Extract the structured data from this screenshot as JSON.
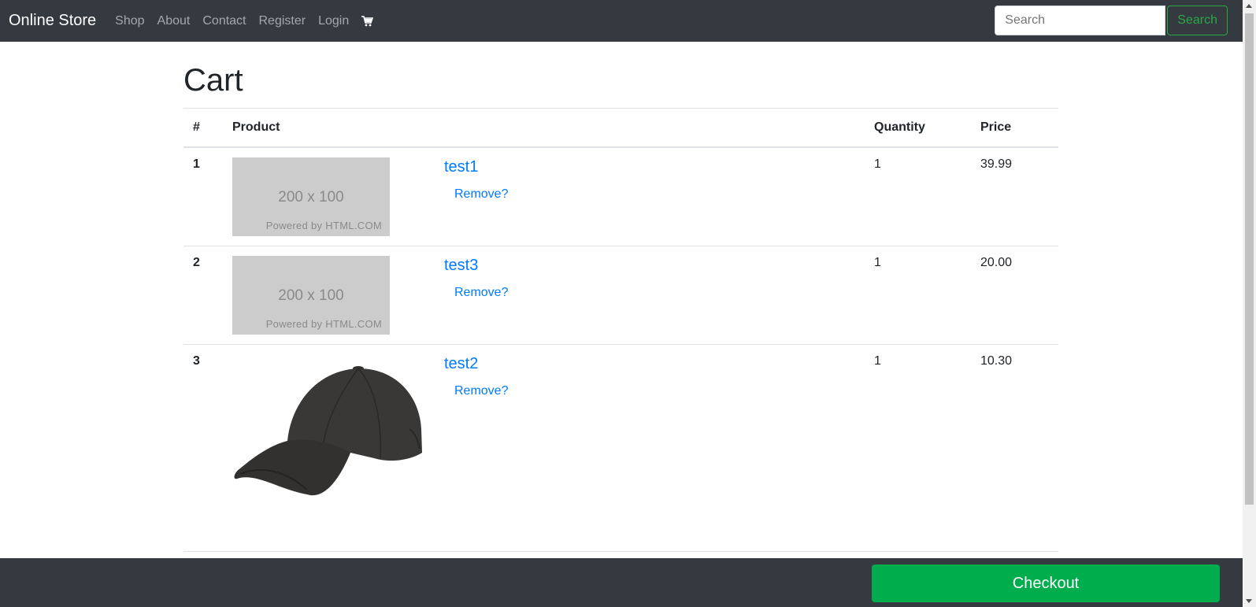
{
  "navbar": {
    "brand": "Online Store",
    "links": [
      "Shop",
      "About",
      "Contact",
      "Register",
      "Login"
    ],
    "cart_icon": "shopping-cart-icon",
    "search_placeholder": "Search",
    "search_button": "Search",
    "bg_color": "#343a40"
  },
  "page": {
    "title": "Cart",
    "columns": [
      "#",
      "Product",
      "Quantity",
      "Price"
    ],
    "rows": [
      {
        "num": "1",
        "image": "placeholder",
        "image_dims": "200 x 100",
        "image_powered": "Powered by HTML.COM",
        "name": "test1",
        "remove": "Remove?",
        "quantity": "1",
        "price": "39.99"
      },
      {
        "num": "2",
        "image": "placeholder",
        "image_dims": "200 x 100",
        "image_powered": "Powered by HTML.COM",
        "name": "test3",
        "remove": "Remove?",
        "quantity": "1",
        "price": "20.00"
      },
      {
        "num": "3",
        "image": "cap-photo",
        "name": "test2",
        "remove": "Remove?",
        "quantity": "1",
        "price": "10.30"
      }
    ]
  },
  "footer": {
    "checkout": "Checkout",
    "checkout_color": "#00ad4d"
  },
  "colors": {
    "link": "#007bff",
    "success_outline": "#28a745"
  }
}
